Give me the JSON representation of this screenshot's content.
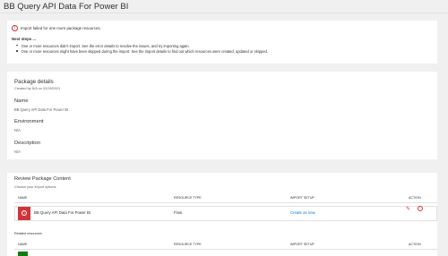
{
  "app": {
    "title": "BB Query API Data For Power BI"
  },
  "status": {
    "icon": "error-icon",
    "message": "Import failed for one more package resources.",
    "next_steps_title": "Next steps ...",
    "bullets": [
      "One or more resources didn't import. See the error details to resolve the issues, and try importing again.",
      "One or more resources might have been skipped during the import. See the import details to find out which resources were created, updated or skipped."
    ]
  },
  "package": {
    "title": "Package details",
    "created_by": "Created by N/A on 02/28/2021",
    "fields": [
      {
        "label": "Name",
        "value": "BB Query API Data For Power BI"
      },
      {
        "label": "Environment",
        "value": "N/A"
      },
      {
        "label": "Description",
        "value": "N/A"
      }
    ]
  },
  "review": {
    "title": "Review Package Content",
    "subtitle": "Choose your import options.",
    "columns": [
      "NAME",
      "RESOURCE TYPE",
      "IMPORT SETUP",
      "ACTION"
    ],
    "rows": [
      {
        "name": "BB Query API Data For Power BI",
        "type": "Flow",
        "setup": "Create as new",
        "status_icon": "error-icon",
        "actions": [
          "edit-icon",
          "error-icon"
        ]
      }
    ],
    "related_title": "Related resources",
    "related_columns": [
      "NAME",
      "RESOURCE TYPE",
      "IMPORT SETUP",
      "ACTION"
    ]
  },
  "colors": {
    "error": "#d13438",
    "link": "#0078d4",
    "success": "#107c10"
  }
}
